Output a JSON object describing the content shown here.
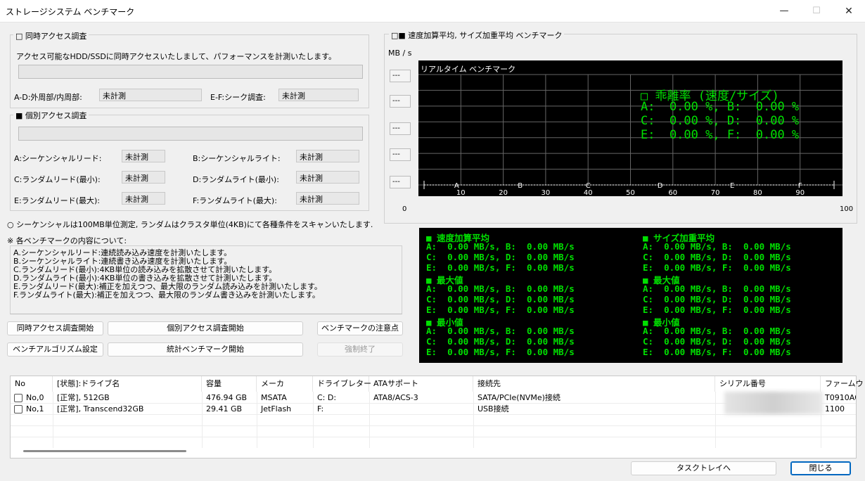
{
  "window": {
    "title": "ストレージシステム ベンチマーク",
    "minimize": "—",
    "maximize": "☐",
    "close": "✕"
  },
  "concurrent": {
    "group_label": "□ 同時アクセス調査",
    "desc": "アクセス可能なHDD/SSDに同時アクセスいたしまして、パフォーマンスを計測いたします。",
    "ad_label": "A-D:外周部/内周部:",
    "ad_value": "未計測",
    "ef_label": "E-F:シーク調査:",
    "ef_value": "未計測"
  },
  "individual": {
    "group_label": "■ 個別アクセス調査",
    "items": [
      {
        "label": "A:シーケンシャルリード:",
        "value": "未計測"
      },
      {
        "label": "B:シーケンシャルライト:",
        "value": "未計測"
      },
      {
        "label": "C:ランダムリード(最小):",
        "value": "未計測"
      },
      {
        "label": "D:ランダムライト(最小):",
        "value": "未計測"
      },
      {
        "label": "E:ランダムリード(最大):",
        "value": "未計測"
      },
      {
        "label": "F:ランダムライト(最大):",
        "value": "未計測"
      }
    ]
  },
  "scan_note": "○ シーケンシャルは100MB単位測定, ランダムはクラスタ単位(4KB)にて各種条件をスキャンいたします.",
  "desc_heading": "※ 各ベンチマークの内容について:",
  "desc_lines": [
    "A.シーケンシャルリード:連続読み込み速度を計測いたします。",
    "B.シーケンシャルライト:連続書き込み速度を計測いたします。",
    "C.ランダムリード(最小):4KB単位の読み込みを拡散させて計測いたします。",
    "D.ランダムライト(最小):4KB単位の書き込みを拡散させて計測いたします。",
    "E.ランダムリード(最大):補正を加えつつ、最大限のランダム読み込みを計測いたします。",
    "F.ランダムライト(最大):補正を加えつつ、最大限のランダム書き込みを計測いたします。"
  ],
  "buttons": {
    "concurrent_start": "同時アクセス調査開始",
    "individual_start": "個別アクセス調査開始",
    "notes": "ベンチマークの注意点",
    "algorithm": "ベンチアルゴリズム設定",
    "stats_start": "統計ベンチマーク開始",
    "force_stop": "強制終了",
    "tray": "タスクトレイへ",
    "close": "閉じる"
  },
  "bench": {
    "group_label": "□■ 速度加算平均, サイズ加重平均 ベンチマーク",
    "unit": "MB / s",
    "y_placeholders": [
      "---",
      "---",
      "---",
      "---",
      "---"
    ],
    "realtime_label": "リアルタイム ベンチマーク",
    "x_min": "0",
    "x_max": "100",
    "ratio_title": "□ 乖離率 (速度/サイズ)",
    "ratio_lines": [
      "A:  0.00 %, B:  0.00 %",
      "C:  0.00 %, D:  0.00 %",
      "E:  0.00 %, F:  0.00 %"
    ]
  },
  "chart_data": {
    "type": "line",
    "title": "リアルタイム ベンチマーク",
    "ylabel": "MB / s",
    "x_ticks": [
      10,
      20,
      30,
      40,
      50,
      60,
      70,
      80,
      90
    ],
    "xlim": [
      0,
      100
    ],
    "markers": [
      "A",
      "B",
      "C",
      "D",
      "E",
      "F"
    ],
    "y_ticks": [
      "---",
      "---",
      "---",
      "---",
      "---"
    ],
    "series": [],
    "grid": true,
    "background": "#000000",
    "grid_color": "#666666",
    "text_color": "#00e000"
  },
  "stats": {
    "left_title": "■ 速度加算平均",
    "right_title": "■ サイズ加重平均",
    "max_title": "■ 最大値",
    "min_title": "■ 最小値",
    "row_ab": "A:  0.00 MB/s, B:  0.00 MB/s",
    "row_cd": "C:  0.00 MB/s, D:  0.00 MB/s",
    "row_ef": "E:  0.00 MB/s, F:  0.00 MB/s"
  },
  "drive_table": {
    "columns": [
      "No",
      "[状態]:ドライブ名",
      "容量",
      "メーカ",
      "ドライブレター",
      "ATAサポート",
      "接続先",
      "シリアル番号",
      "ファームウ"
    ],
    "rows": [
      [
        "No,0",
        "[正常], 512GB",
        "476.94 GB",
        "MSATA",
        "C: D:",
        "ATA8/ACS-3",
        "SATA/PCIe(NVMe)接続",
        "",
        "T0910A0"
      ],
      [
        "No,1",
        "[正常], Transcend32GB",
        "29.41 GB",
        "JetFlash",
        "F:",
        "",
        "USB接続",
        "",
        "1100"
      ]
    ]
  },
  "colors": {
    "accent": "#0067c0",
    "terminal_green": "#00e000",
    "terminal_bg": "#000000"
  }
}
